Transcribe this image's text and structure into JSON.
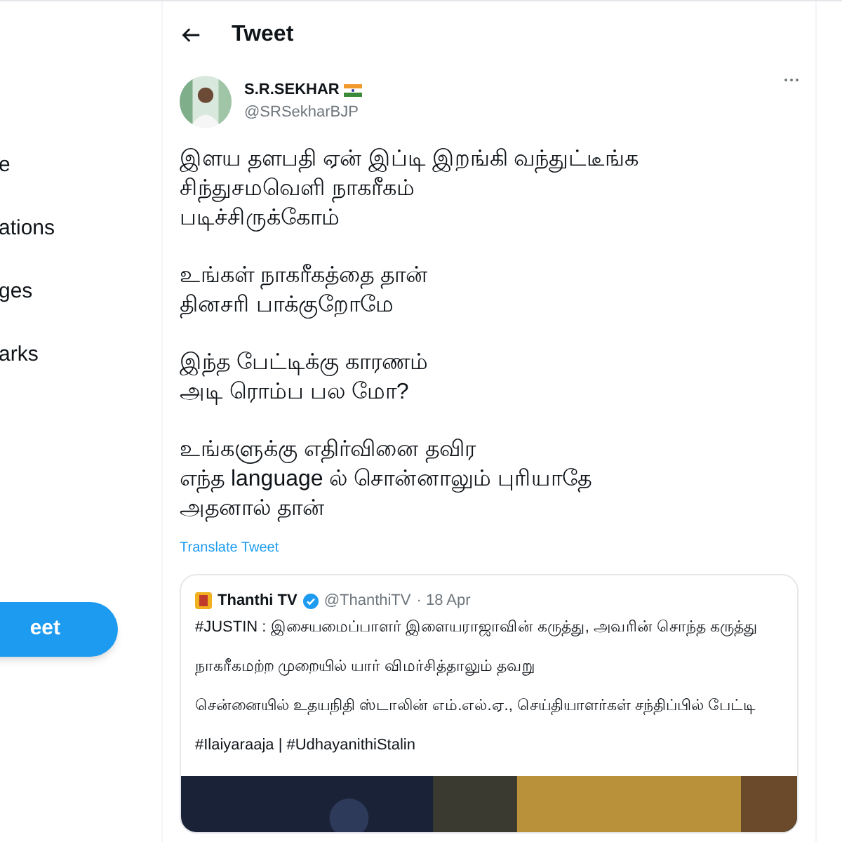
{
  "sidebar": {
    "items": [
      {
        "label": "e"
      },
      {
        "label": "ations"
      },
      {
        "label": "ges"
      },
      {
        "label": "arks"
      }
    ],
    "tweet_button": "eet"
  },
  "header": {
    "title": "Tweet"
  },
  "tweet": {
    "name": "S.R.SEKHAR",
    "handle": "@SRSekharBJP",
    "paragraphs": [
      [
        "இளய தளபதி ஏன் இப்டி இறங்கி வந்துட்டீங்க",
        "சிந்துசமவெளி நாகரீகம்",
        "படிச்சிருக்கோம்"
      ],
      [
        "உங்கள் நாகரீகத்தை தான்",
        "தினசரி பாக்குறோமே"
      ],
      [
        "இந்த பேட்டிக்கு காரணம்",
        "அடி ரொம்ப பல மோ?"
      ],
      [
        "உங்களுக்கு எதிர்வினை தவிர",
        "எந்த language ல் சொன்னாலும் புரியாதே",
        "அதனால் தான்"
      ]
    ],
    "translate": "Translate Tweet",
    "quote": {
      "name": "Thanthi TV",
      "verified": true,
      "handle": "@ThanthiTV",
      "time": "· 18 Apr",
      "paragraphs": [
        "#JUSTIN : இசையமைப்பாளர் இளையராஜாவின் கருத்து, அவரின் சொந்த கருத்து",
        "நாகரீகமற்ற முறையில் யார் விமர்சித்தாலும் தவறு",
        "சென்னையில் உதயநிதி ஸ்டாலின் எம்.எல்.ஏ., செய்தியாளர்கள் சந்திப்பில் பேட்டி",
        "#Ilaiyaraaja | #UdhayanithiStalin"
      ]
    }
  }
}
